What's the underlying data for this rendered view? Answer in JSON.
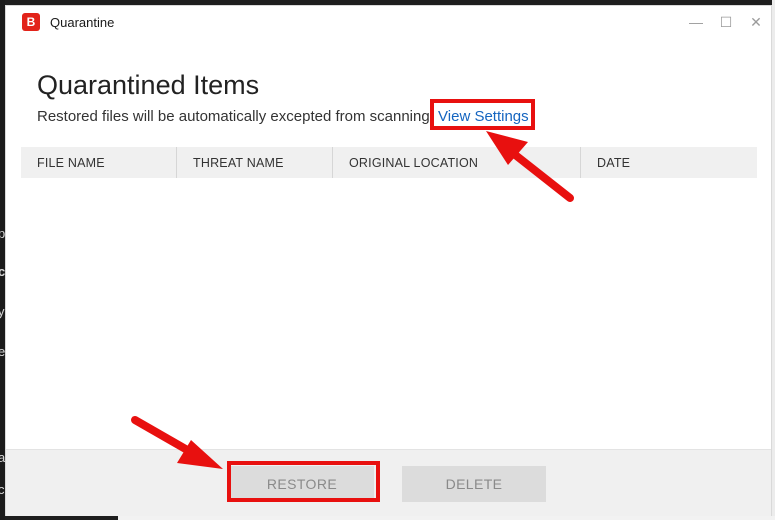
{
  "window": {
    "title": "Quarantine",
    "logo_letter": "B",
    "controls": {
      "minimize": "—",
      "maximize": "☐",
      "close": "✕"
    }
  },
  "page": {
    "heading": "Quarantined Items",
    "subtitle": "Restored files will be automatically excepted from scanning.",
    "settings_link": "View Settings"
  },
  "table": {
    "columns": [
      "FILE NAME",
      "THREAT NAME",
      "ORIGINAL LOCATION",
      "DATE"
    ],
    "rows": []
  },
  "footer": {
    "restore_label": "RESTORE",
    "delete_label": "DELETE"
  },
  "background": {
    "left_fragments": [
      "p",
      "c",
      "y",
      "e",
      "a",
      "c"
    ]
  },
  "colors": {
    "accent_link": "#1565c0",
    "brand_red": "#e2231a",
    "annotation_red": "#e8100f"
  }
}
